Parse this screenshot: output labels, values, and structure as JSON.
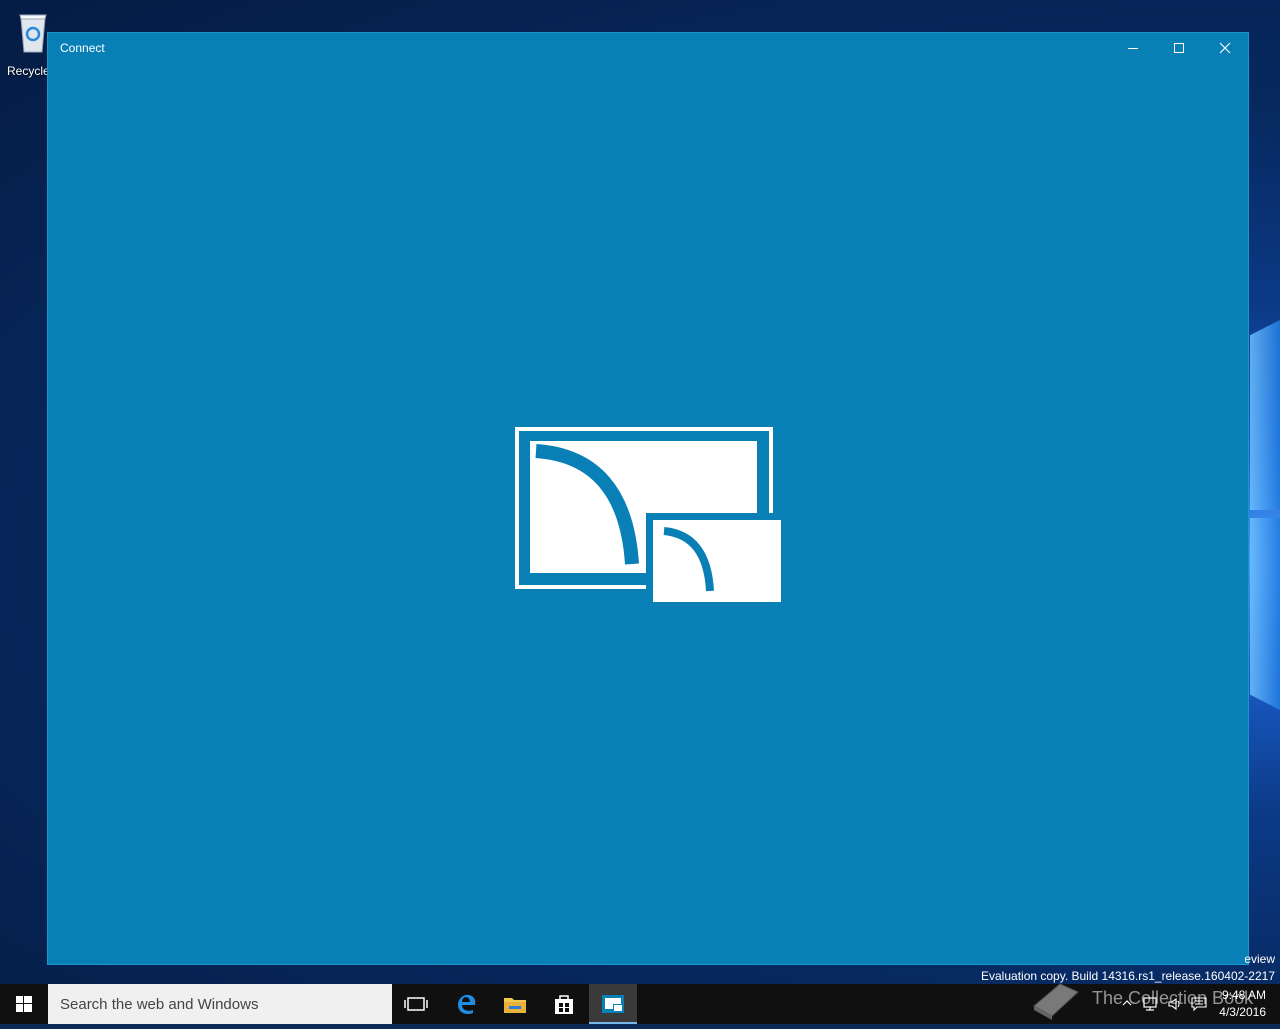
{
  "desktop": {
    "recycle_bin_label": "Recycle"
  },
  "window": {
    "title": "Connect",
    "controls": [
      "minimize",
      "maximize",
      "close"
    ],
    "background": "#087fb5",
    "logo_icon": "connect-projection-icon"
  },
  "desktop_overlay": {
    "edition_line": "eview",
    "build_line": "Evaluation copy. Build 14316.rs1_release.160402-2217"
  },
  "taskbar": {
    "search_placeholder": "Search the web and Windows",
    "apps": [
      "task-view-icon",
      "edge-icon",
      "file-explorer-icon",
      "store-icon",
      "connect-app-icon"
    ],
    "active_app": "connect-app-icon",
    "clock_time": "9:48 AM",
    "clock_date": "4/3/2016",
    "tray_icons": [
      "chevron-up-icon",
      "network-icon",
      "volume-icon",
      "action-center-icon"
    ]
  },
  "watermark": {
    "text": "The Collection Book"
  }
}
